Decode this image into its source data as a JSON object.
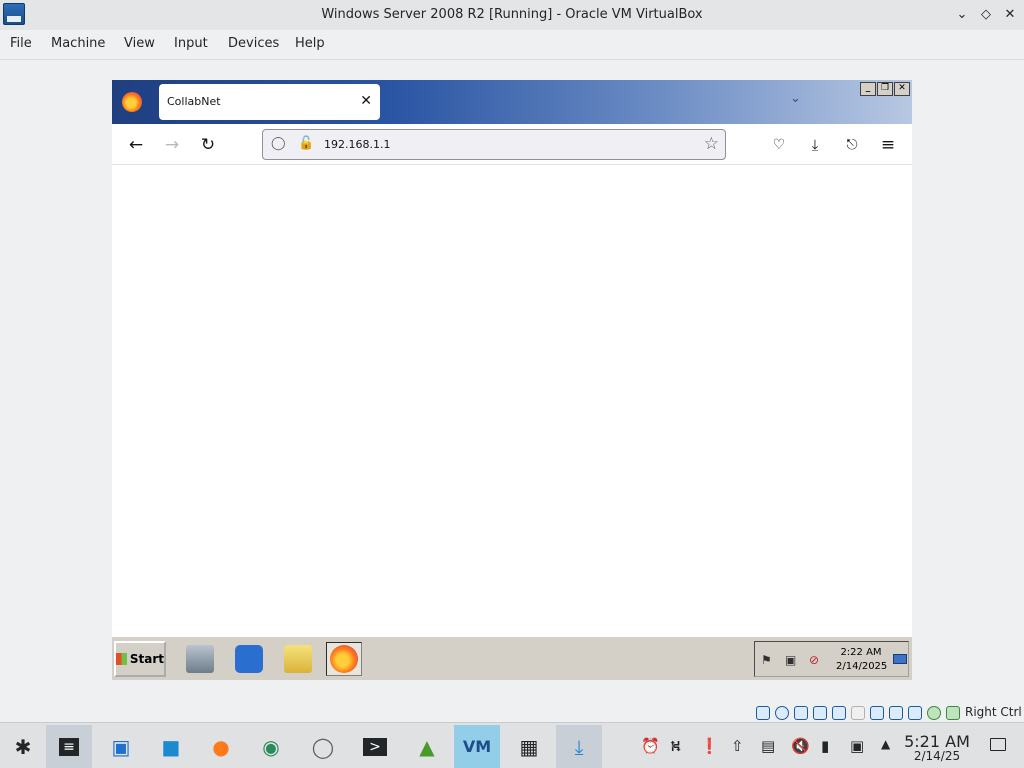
{
  "vbox": {
    "title": "Windows Server 2008 R2 [Running] - Oracle VM VirtualBox",
    "menu": [
      "File",
      "Machine",
      "View",
      "Input",
      "Devices",
      "Help"
    ],
    "host_key_label": "Right Ctrl",
    "status_icons": [
      "hard-disk-icon",
      "optical-drive-icon",
      "audio-icon",
      "network-icon",
      "usb-icon",
      "shared-folders-icon",
      "display-icon",
      "recording-icon",
      "cpu-icon",
      "mouse-integration-icon",
      "keyboard-icon"
    ]
  },
  "firefox": {
    "tab_title": "CollabNet",
    "url": "192.168.1.1",
    "page_content": ""
  },
  "guest_taskbar": {
    "start_label": "Start",
    "quick_launch": [
      "server-manager-icon",
      "powershell-icon",
      "windows-explorer-icon",
      "firefox-icon"
    ],
    "active_item": "firefox-icon",
    "time": "2:22 AM",
    "date": "2/14/2025"
  },
  "host_panel": {
    "tasks": [
      "application-launcher-icon",
      "system-settings-icon",
      "remote-desktop-icon",
      "file-manager-icon",
      "firefox-icon",
      "globe-icon",
      "shield-icon",
      "terminal-icon",
      "update-icon",
      "virtualbox-icon",
      "package-manager-icon",
      "download-icon"
    ],
    "active_task": "virtualbox-icon",
    "time": "5:21 AM",
    "date": "2/14/25"
  },
  "colors": {
    "vbox_bg": "#eff0f1",
    "ff_tab_gradient_start": "#1f3f80",
    "ff_tab_gradient_end": "#b8c8e2",
    "win_classic_gray": "#d4d0c8",
    "kde_active_task": "#93cee9"
  }
}
